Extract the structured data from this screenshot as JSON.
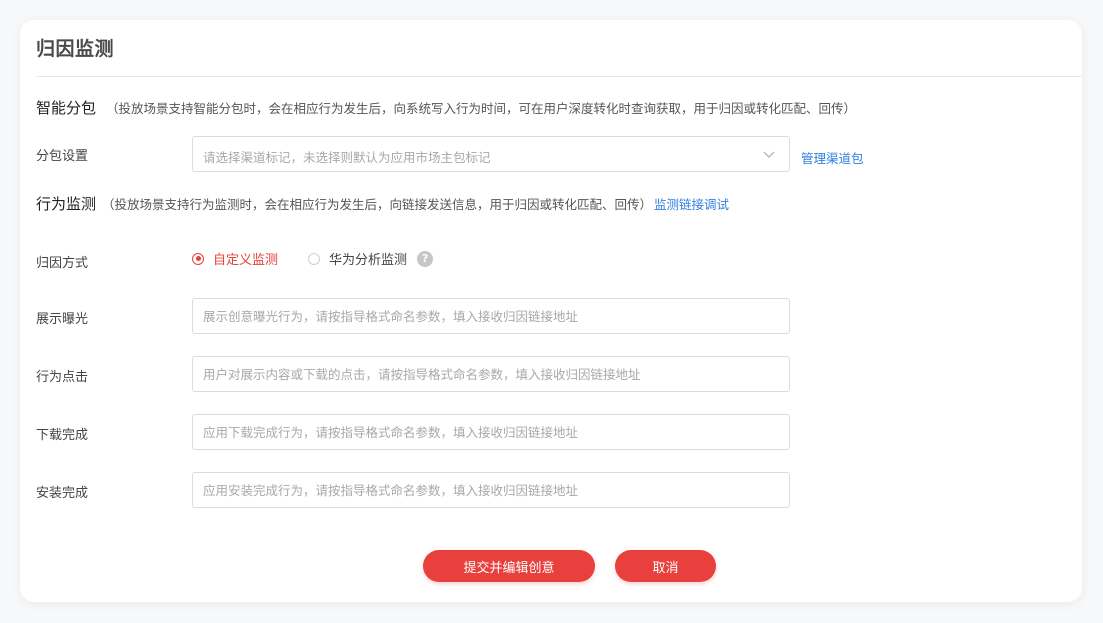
{
  "card": {
    "title": "归因监测"
  },
  "smart_package": {
    "title": "智能分包",
    "desc": "（投放场景支持智能分包时，会在相应行为发生后，向系统写入行为时间，可在用户深度转化时查询获取，用于归因或转化匹配、回传）",
    "setting_label": "分包设置",
    "select_placeholder": "请选择渠道标记，未选择则默认为应用市场主包标记",
    "manage_link": "管理渠道包"
  },
  "behavior_monitor": {
    "title": "行为监测",
    "desc": "（投放场景支持行为监测时，会在相应行为发生后，向链接发送信息，用于归因或转化匹配、回传）",
    "debug_link": "监测链接调试",
    "attribution_label": "归因方式",
    "options": [
      {
        "label": "自定义监测",
        "checked": true
      },
      {
        "label": "华为分析监测",
        "checked": false
      }
    ],
    "help_glyph": "?",
    "fields": [
      {
        "label": "展示曝光",
        "placeholder": "展示创意曝光行为，请按指导格式命名参数，填入接收归因链接地址",
        "value": ""
      },
      {
        "label": "行为点击",
        "placeholder": "用户对展示内容或下载的点击，请按指导格式命名参数，填入接收归因链接地址",
        "value": ""
      },
      {
        "label": "下载完成",
        "placeholder": "应用下载完成行为，请按指导格式命名参数，填入接收归因链接地址",
        "value": ""
      },
      {
        "label": "安装完成",
        "placeholder": "应用安装完成行为，请按指导格式命名参数，填入接收归因链接地址",
        "value": ""
      }
    ]
  },
  "actions": {
    "submit_label": "提交并编辑创意",
    "cancel_label": "取消"
  },
  "colors": {
    "accent": "#e8403c",
    "link": "#2f7fe0"
  }
}
